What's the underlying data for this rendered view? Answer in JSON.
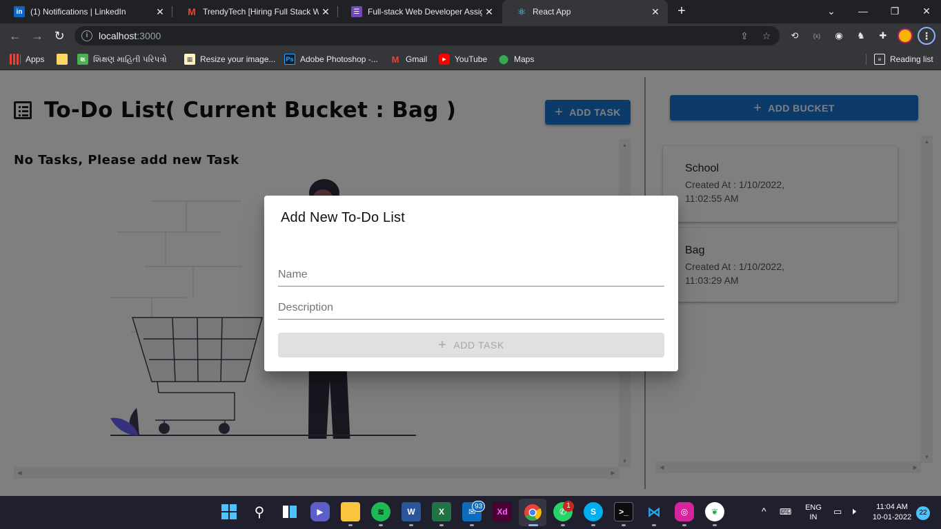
{
  "browser": {
    "tabs": [
      {
        "title": "(1) Notifications | LinkedIn",
        "icon": "linkedin-icon",
        "active": false
      },
      {
        "title": "TrendyTech [Hiring Full Stack Web",
        "icon": "gmail-icon",
        "active": false
      },
      {
        "title": "Full-stack Web Developer Assignm",
        "icon": "forms-icon",
        "active": false
      },
      {
        "title": "React App",
        "icon": "react-icon",
        "active": true
      }
    ],
    "new_tab": "+",
    "address": {
      "host": "localhost",
      "port": ":3000"
    },
    "bookmarks": [
      {
        "label": "Apps",
        "icon": "apps-grid-icon"
      },
      {
        "label": "",
        "icon": "folder-icon"
      },
      {
        "label": "શિક્ષણ માહિતી પરિપત્રો",
        "icon": "site-icon"
      },
      {
        "label": "Resize your image...",
        "icon": "site-icon"
      },
      {
        "label": "Adobe Photoshop -...",
        "icon": "photoshop-icon"
      },
      {
        "label": "Gmail",
        "icon": "gmail-icon"
      },
      {
        "label": "YouTube",
        "icon": "youtube-icon"
      },
      {
        "label": "Maps",
        "icon": "maps-icon"
      }
    ],
    "reading_list": "Reading list"
  },
  "app": {
    "title": "To-Do List( Current Bucket : Bag )",
    "add_task_label": "ADD TASK",
    "empty_message": "No Tasks, Please add new Task",
    "add_bucket_label": "ADD BUCKET",
    "buckets": [
      {
        "name": "School",
        "created": "Created At : 1/10/2022, 11:02:55 AM"
      },
      {
        "name": "Bag",
        "created": "Created At : 1/10/2022, 11:03:29 AM"
      }
    ]
  },
  "dialog": {
    "title": "Add New To-Do List",
    "name_placeholder": "Name",
    "description_placeholder": "Description",
    "submit_label": "ADD TASK"
  },
  "taskbar": {
    "whatsapp_badge": "1",
    "mail_badge": "93",
    "language": "ENG",
    "region": "IN",
    "time": "11:04 AM",
    "date": "10-01-2022",
    "notification_count": "22"
  },
  "colors": {
    "primary": "#1976d2",
    "backdrop": "rgba(0,0,0,0.5)",
    "chrome_dark": "#202124"
  }
}
